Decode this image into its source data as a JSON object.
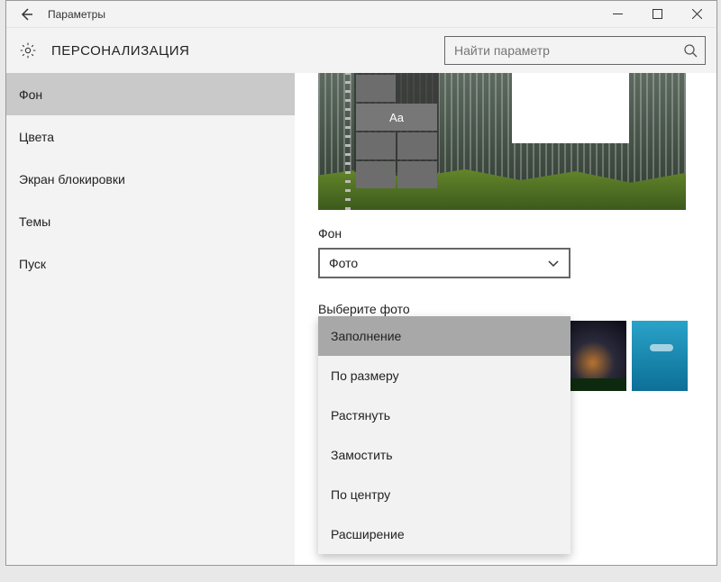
{
  "titlebar": {
    "title": "Параметры"
  },
  "header": {
    "heading": "ПЕРСОНАЛИЗАЦИЯ",
    "search_placeholder": "Найти параметр"
  },
  "sidebar": {
    "items": [
      {
        "label": "Фон",
        "active": true
      },
      {
        "label": "Цвета",
        "active": false
      },
      {
        "label": "Экран блокировки",
        "active": false
      },
      {
        "label": "Темы",
        "active": false
      },
      {
        "label": "Пуск",
        "active": false
      }
    ]
  },
  "content": {
    "preview_tile_text": "Aa",
    "background_label": "Фон",
    "background_value": "Фото",
    "choose_photo_label": "Выберите фото"
  },
  "fit_dropdown": {
    "options": [
      {
        "label": "Заполнение",
        "active": true
      },
      {
        "label": "По размеру",
        "active": false
      },
      {
        "label": "Растянуть",
        "active": false
      },
      {
        "label": "Замостить",
        "active": false
      },
      {
        "label": "По центру",
        "active": false
      },
      {
        "label": "Расширение",
        "active": false
      }
    ]
  }
}
